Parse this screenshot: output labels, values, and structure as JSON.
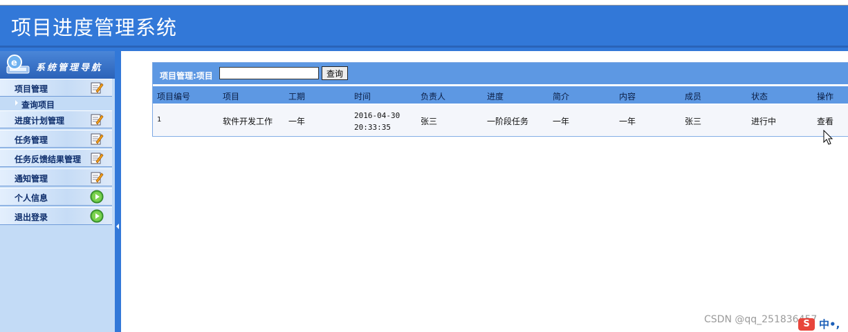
{
  "app": {
    "title": "项目进度管理系统"
  },
  "sidebar": {
    "title": "系统管理导航",
    "items": [
      {
        "label": "项目管理",
        "icon": "edit-icon"
      },
      {
        "label": "进度计划管理",
        "icon": "edit-icon"
      },
      {
        "label": "任务管理",
        "icon": "edit-icon"
      },
      {
        "label": "任务反馈结果管理",
        "icon": "edit-icon"
      },
      {
        "label": "通知管理",
        "icon": "edit-icon"
      },
      {
        "label": "个人信息",
        "icon": "play-icon"
      },
      {
        "label": "退出登录",
        "icon": "play-icon"
      }
    ],
    "sub_items": [
      {
        "label": "查询项目"
      }
    ]
  },
  "main": {
    "panel_label": "项目管理:项目",
    "search": {
      "value": "",
      "button": "查询"
    },
    "table": {
      "headers": [
        "项目编号",
        "项目",
        "工期",
        "时间",
        "负责人",
        "进度",
        "简介",
        "内容",
        "成员",
        "状态",
        "操作"
      ],
      "rows": [
        {
          "id": "1",
          "project": "软件开发工作",
          "duration": "一年",
          "time_date": "2016-04-30",
          "time_clock": "20:33:35",
          "owner": "张三",
          "progress": "一阶段任务",
          "summary": "一年",
          "content": "一年",
          "members": "张三",
          "status": "进行中",
          "action": "查看"
        }
      ]
    }
  },
  "footer": {
    "watermark": "CSDN @qq_251836457",
    "ime_badge": "S",
    "ime_text": "中•,"
  },
  "colors": {
    "header_blue": "#3278d8",
    "panel_blue": "#5d98e3",
    "sidebar_bg": "#c3dbf6"
  }
}
